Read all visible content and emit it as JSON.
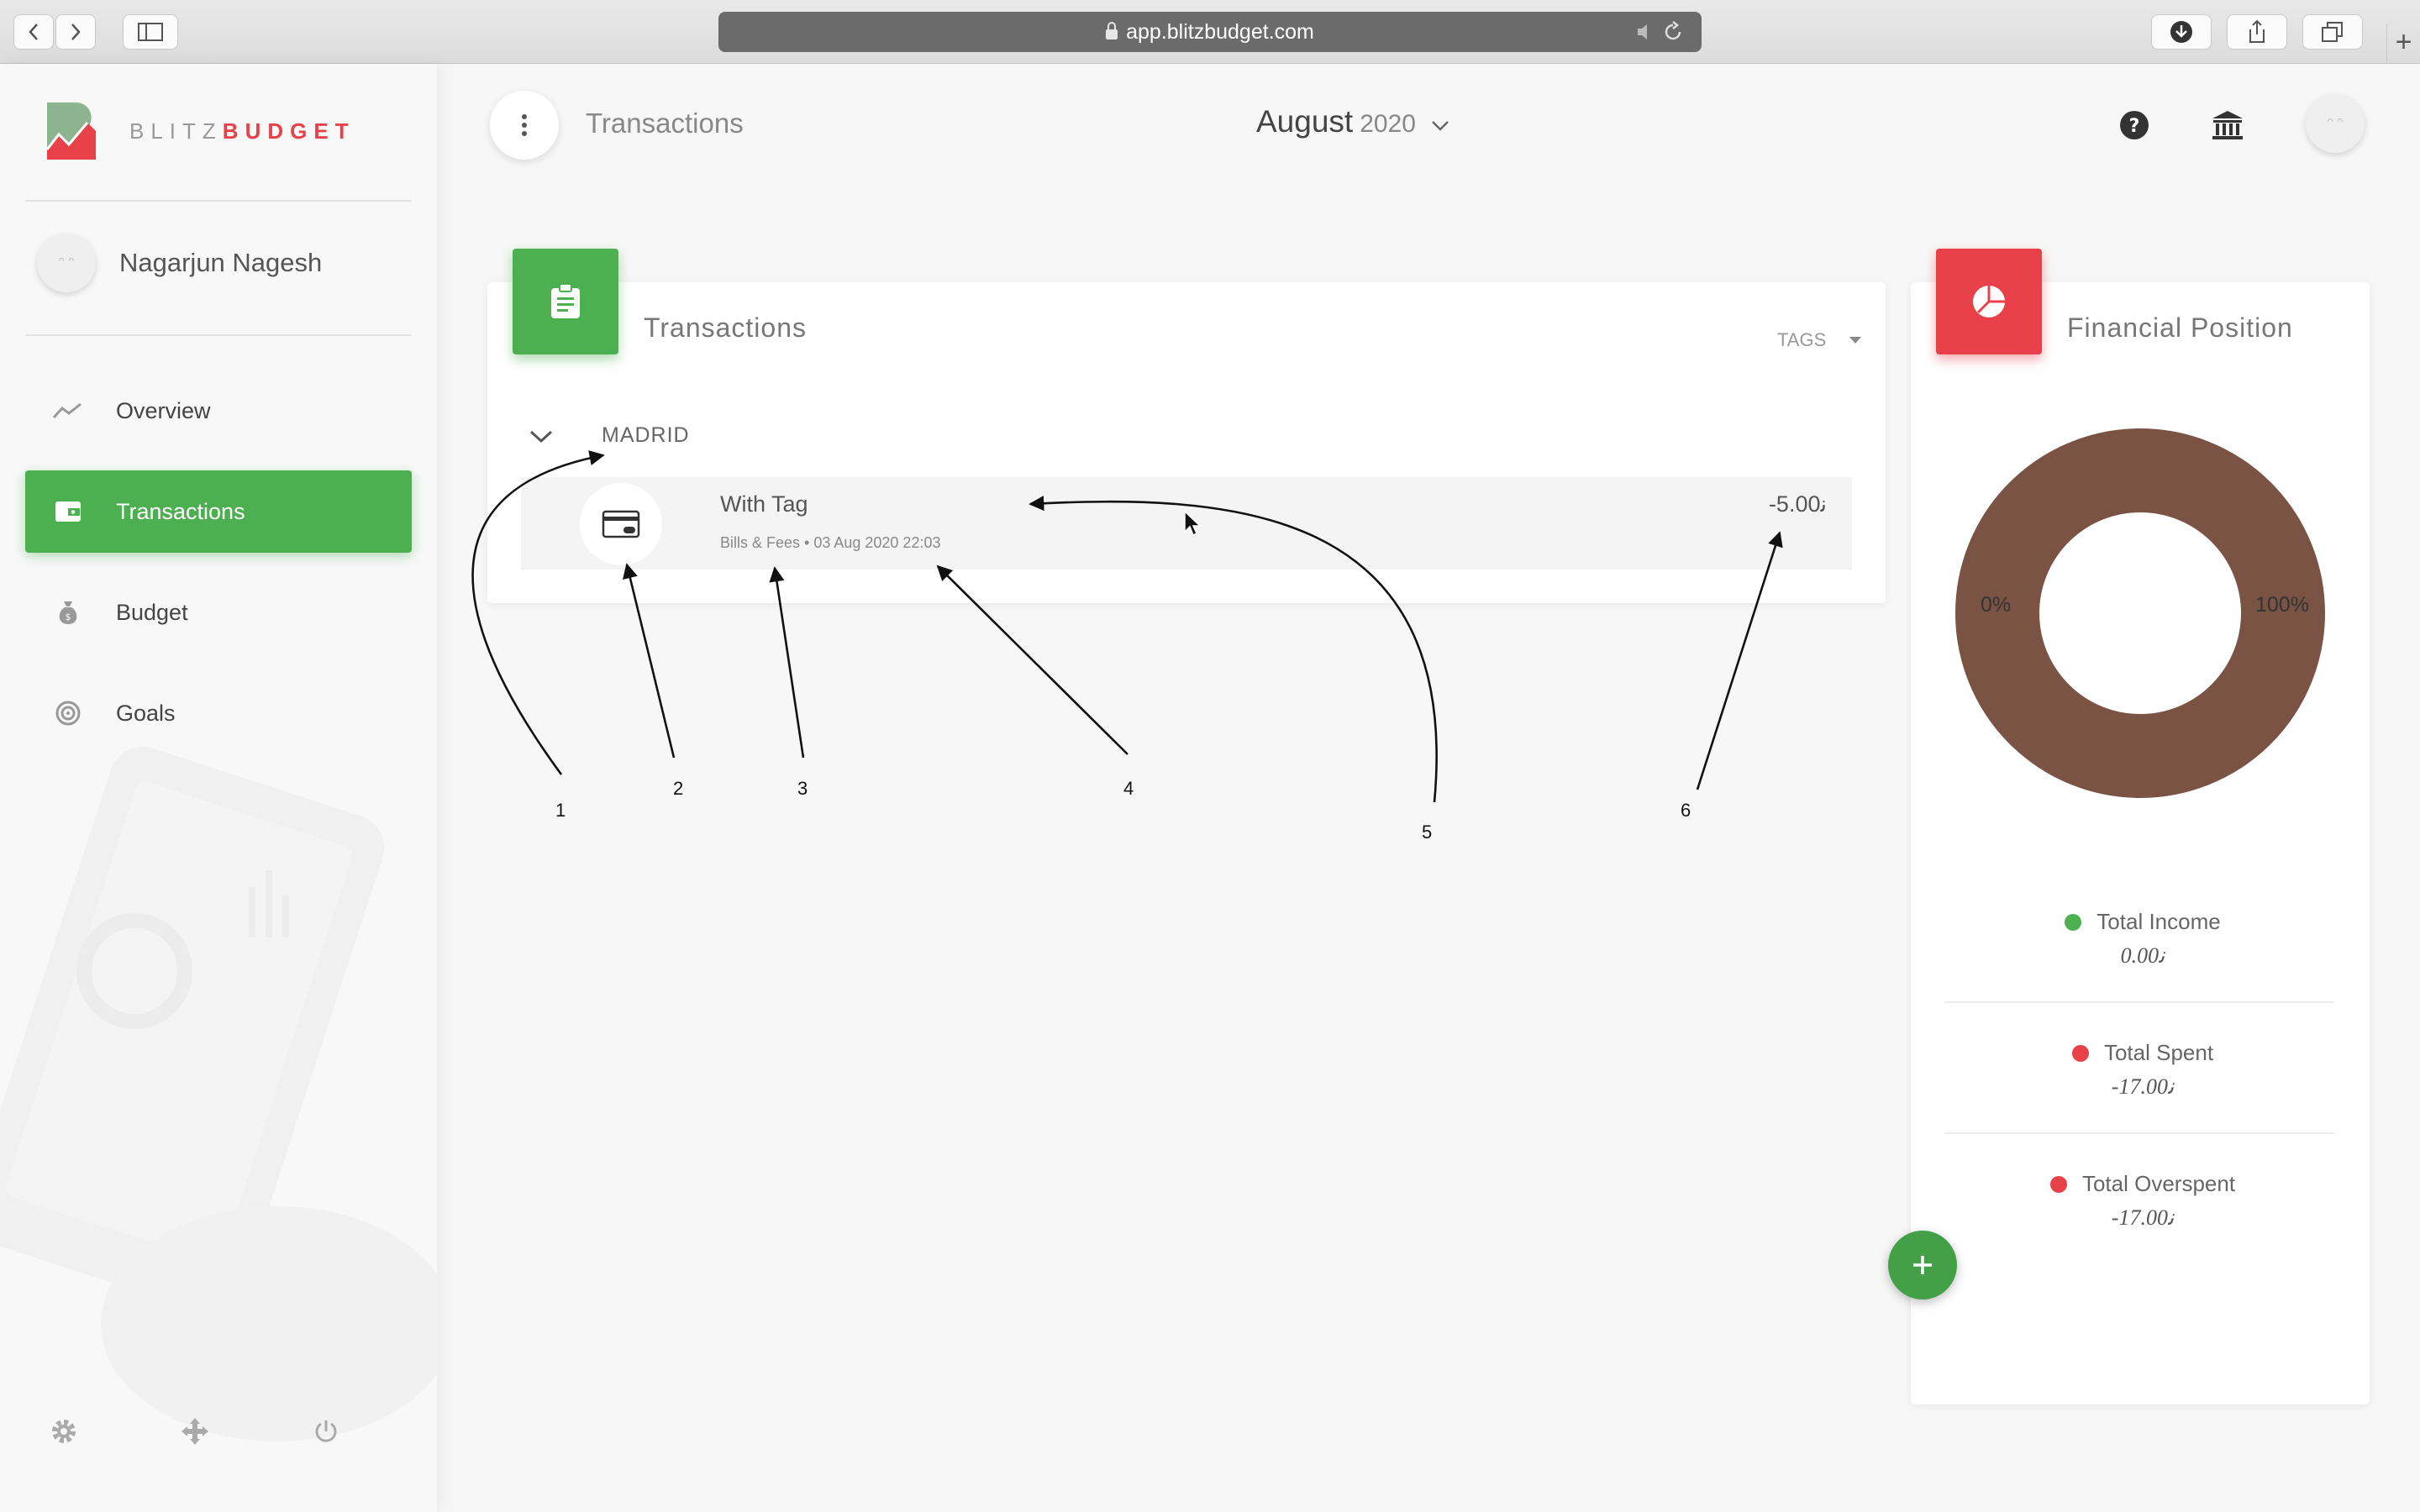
{
  "browser": {
    "url": "app.blitzbudget.com"
  },
  "sidebar": {
    "brand_prefix": "BLITZ",
    "brand_suffix": "BUDGET",
    "user_name": "Nagarjun Nagesh",
    "items": [
      {
        "label": "Overview",
        "icon": "trend-icon",
        "active": false
      },
      {
        "label": "Transactions",
        "icon": "wallet-icon",
        "active": true
      },
      {
        "label": "Budget",
        "icon": "money-bag-icon",
        "active": false
      },
      {
        "label": "Goals",
        "icon": "target-icon",
        "active": false
      }
    ],
    "bottom_icons": [
      "gear-icon",
      "move-icon",
      "power-icon"
    ]
  },
  "header": {
    "page_title": "Transactions",
    "month": "August",
    "year": "2020",
    "icons": [
      "help-icon",
      "bank-icon"
    ]
  },
  "transactions_card": {
    "title": "Transactions",
    "tags_label": "TAGS",
    "group": {
      "name": "MADRID",
      "transactions": [
        {
          "name": "With Tag",
          "meta": "Bills & Fees • 03 Aug 2020 22:03",
          "amount": "-5.00ﻧ",
          "icon": "credit-card-icon"
        }
      ]
    }
  },
  "annotations": [
    "1",
    "2",
    "3",
    "4",
    "5",
    "6"
  ],
  "financial_card": {
    "title": "Financial Position",
    "donut_left_label": "0%",
    "donut_right_label": "100%",
    "totals": [
      {
        "label": "Total Income",
        "value": "0.00ﻧ",
        "color": "#4caf50"
      },
      {
        "label": "Total Spent",
        "value": "-17.00ﻧ",
        "color": "#e8414a"
      },
      {
        "label": "Total Overspent",
        "value": "-17.00ﻧ",
        "color": "#e8414a"
      }
    ]
  },
  "colors": {
    "accent_green": "#4caf50",
    "accent_red": "#e8414a",
    "donut_brown": "#7a5345"
  }
}
